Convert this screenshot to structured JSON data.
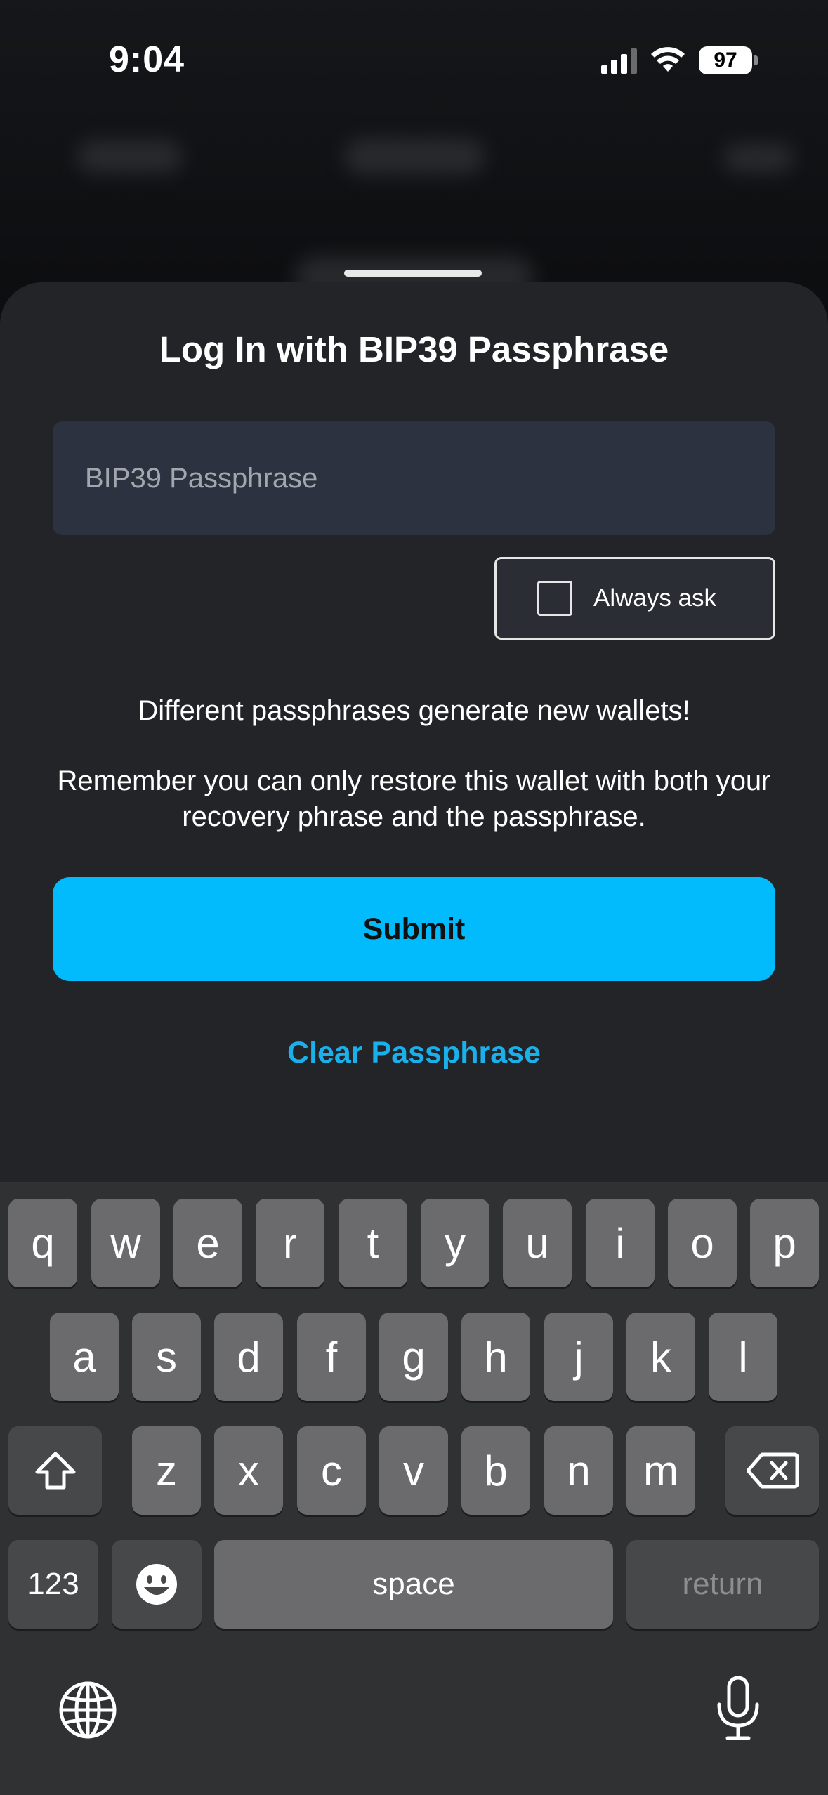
{
  "status_bar": {
    "time": "9:04",
    "battery": "97"
  },
  "sheet": {
    "title": "Log In with BIP39 Passphrase",
    "input_placeholder": "BIP39 Passphrase",
    "always_ask_label": "Always ask",
    "info_line_1": "Different passphrases generate new wallets!",
    "info_line_2": "Remember you can only restore this wallet with both your recovery phrase and the passphrase.",
    "submit_label": "Submit",
    "clear_label": "Clear Passphrase",
    "accent_color": "#01bbfd"
  },
  "keyboard": {
    "row1": [
      "q",
      "w",
      "e",
      "r",
      "t",
      "y",
      "u",
      "i",
      "o",
      "p"
    ],
    "row2": [
      "a",
      "s",
      "d",
      "f",
      "g",
      "h",
      "j",
      "k",
      "l"
    ],
    "row3": [
      "z",
      "x",
      "c",
      "v",
      "b",
      "n",
      "m"
    ],
    "shift_icon": "shift-icon",
    "delete_icon": "delete-icon",
    "numbers_label": "123",
    "emoji_icon": "emoji-icon",
    "space_label": "space",
    "return_label": "return",
    "globe_icon": "globe-icon",
    "mic_icon": "microphone-icon"
  }
}
